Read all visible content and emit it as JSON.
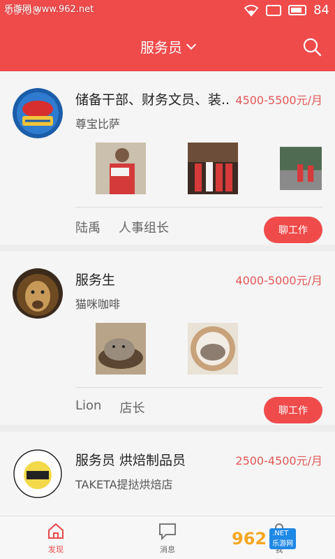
{
  "watermark": {
    "site": "乐游网 www.962.net",
    "logo": "962",
    "logo_sub_top": ".NET",
    "logo_sub_bottom": "乐游网"
  },
  "status_bar": {
    "time": "09:08",
    "battery": "84"
  },
  "header": {
    "title": "服务员"
  },
  "jobs": [
    {
      "title": "储备干部、财务文员、装..",
      "salary": "4500-5500元/月",
      "company": "尊宝比萨",
      "contact_name": "陆禹",
      "contact_role": "人事组长",
      "chat_label": "聊工作"
    },
    {
      "title": "服务生",
      "salary": "4000-5000元/月",
      "company": "猫咪咖啡",
      "contact_name": "Lion",
      "contact_role": "店长",
      "chat_label": "聊工作"
    },
    {
      "title": "服务员 烘焙制品员",
      "salary": "2500-4500元/月",
      "company": "TAKETA提挞烘焙店"
    }
  ],
  "bottom_nav": [
    {
      "label": "发现",
      "icon": "home-icon"
    },
    {
      "label": "消息",
      "icon": "message-icon"
    },
    {
      "label": "我",
      "icon": "person-icon"
    }
  ],
  "colors": {
    "brand": "#ef4b4b",
    "salary": "#e35757"
  }
}
